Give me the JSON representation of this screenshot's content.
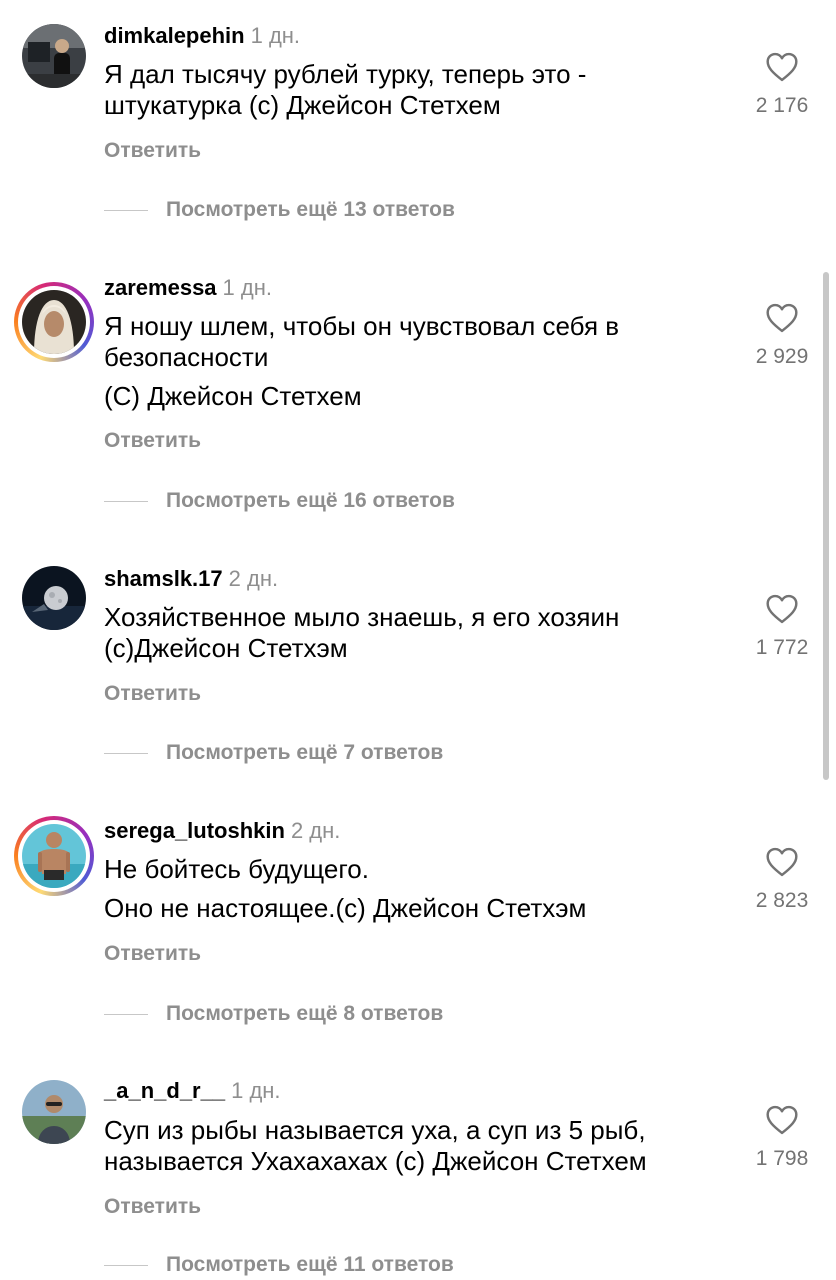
{
  "comments": [
    {
      "username": "dimkalepehin",
      "time": "1 дн.",
      "lines": [
        "Я дал тысячу рублей турку, теперь это -",
        "штукатурка (с) Джейсон Стетхем"
      ],
      "likes": "2 176",
      "reply": "Ответить",
      "more": "Посмотреть ещё 13 ответов"
    },
    {
      "username": "zaremessa",
      "time": "1 дн.",
      "lines": [
        "Я ношу шлем, чтобы он чувствовал себя в",
        "безопасности",
        "(С) Джейсон Стетхем"
      ],
      "likes": "2 929",
      "reply": "Ответить",
      "more": "Посмотреть ещё 16 ответов"
    },
    {
      "username": "shamslk.17",
      "time": "2 дн.",
      "lines": [
        "Хозяйственное мыло знаешь, я его хозяин",
        "(с)Джейсон Стетхэм"
      ],
      "likes": "1 772",
      "reply": "Ответить",
      "more": "Посмотреть ещё 7 ответов"
    },
    {
      "username": "serega_lutoshkin",
      "time": "2 дн.",
      "lines": [
        "Не бойтесь будущего.",
        "Оно не настоящее.(с) Джейсон Стетхэм"
      ],
      "likes": "2 823",
      "reply": "Ответить",
      "more": "Посмотреть ещё 8 ответов"
    },
    {
      "username": "_a_n_d_r__",
      "time": "1 дн.",
      "lines": [
        "Суп из рыбы называется уха, а суп из 5 рыб,",
        "называется Ухахахахах (с) Джейсон Стетхем"
      ],
      "likes": "1 798",
      "reply": "Ответить",
      "more": "Посмотреть ещё 11 ответов"
    }
  ],
  "icons": {
    "like": "heart-outline-icon"
  },
  "colors": {
    "text": "#000000",
    "secondary": "#8e8e8e",
    "story_ring": [
      "#feda75",
      "#fa7e1e",
      "#d62976",
      "#962fbf",
      "#4f5bd5"
    ]
  }
}
